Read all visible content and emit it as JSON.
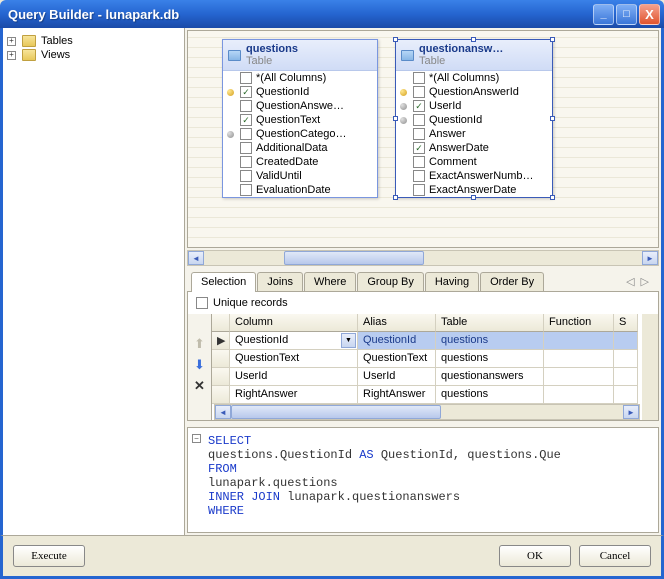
{
  "window": {
    "title": "Query Builder - lunapark.db"
  },
  "tree": {
    "items": [
      {
        "label": "Tables",
        "expanded": false
      },
      {
        "label": "Views",
        "expanded": false
      }
    ]
  },
  "designer": {
    "tables": [
      {
        "name": "questions",
        "sub": "Table",
        "selected": false,
        "columns": [
          {
            "name": "*(All Columns)",
            "checked": false,
            "key": ""
          },
          {
            "name": "QuestionId",
            "checked": true,
            "key": "pk"
          },
          {
            "name": "QuestionAnswe…",
            "checked": false,
            "key": ""
          },
          {
            "name": "QuestionText",
            "checked": true,
            "key": ""
          },
          {
            "name": "QuestionCatego…",
            "checked": false,
            "key": "gk"
          },
          {
            "name": "AdditionalData",
            "checked": false,
            "key": ""
          },
          {
            "name": "CreatedDate",
            "checked": false,
            "key": ""
          },
          {
            "name": "ValidUntil",
            "checked": false,
            "key": ""
          },
          {
            "name": "EvaluationDate",
            "checked": false,
            "key": ""
          }
        ]
      },
      {
        "name": "questionansw…",
        "sub": "Table",
        "selected": true,
        "columns": [
          {
            "name": "*(All Columns)",
            "checked": false,
            "key": ""
          },
          {
            "name": "QuestionAnswerId",
            "checked": false,
            "key": "pk"
          },
          {
            "name": "UserId",
            "checked": true,
            "key": "gk"
          },
          {
            "name": "QuestionId",
            "checked": false,
            "key": "gk"
          },
          {
            "name": "Answer",
            "checked": false,
            "key": ""
          },
          {
            "name": "AnswerDate",
            "checked": true,
            "key": ""
          },
          {
            "name": "Comment",
            "checked": false,
            "key": ""
          },
          {
            "name": "ExactAnswerNumb…",
            "checked": false,
            "key": ""
          },
          {
            "name": "ExactAnswerDate",
            "checked": false,
            "key": ""
          }
        ]
      }
    ]
  },
  "tabs": [
    "Selection",
    "Joins",
    "Where",
    "Group By",
    "Having",
    "Order By"
  ],
  "active_tab": "Selection",
  "unique_label": "Unique records",
  "grid": {
    "headers": [
      "Column",
      "Alias",
      "Table",
      "Function",
      "S"
    ],
    "rows": [
      {
        "marker": "▶",
        "column": "QuestionId",
        "alias": "QuestionId",
        "table": "questions",
        "function": "",
        "s": "",
        "selected": true
      },
      {
        "marker": "",
        "column": "QuestionText",
        "alias": "QuestionText",
        "table": "questions",
        "function": "",
        "s": "",
        "selected": false
      },
      {
        "marker": "",
        "column": "UserId",
        "alias": "UserId",
        "table": "questionanswers",
        "function": "",
        "s": "",
        "selected": false
      },
      {
        "marker": "",
        "column": "RightAnswer",
        "alias": "RightAnswer",
        "table": "questions",
        "function": "",
        "s": "",
        "selected": false
      }
    ]
  },
  "sql": {
    "l1": "SELECT",
    "l2a": "   questions.QuestionId ",
    "l2k": "AS",
    "l2b": " QuestionId, questions.Que",
    "l3": "FROM",
    "l4": "   lunapark.questions",
    "l5k": "   INNER JOIN",
    "l5t": " lunapark.questionanswers",
    "l6": "WHERE"
  },
  "buttons": {
    "execute": "Execute",
    "ok": "OK",
    "cancel": "Cancel"
  }
}
